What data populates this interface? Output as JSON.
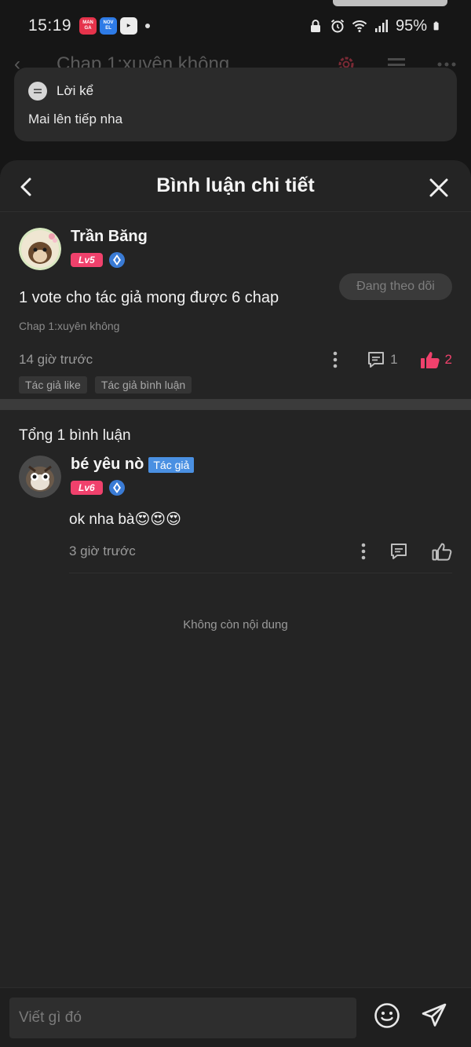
{
  "status_bar": {
    "time": "15:19",
    "apps": [
      "MANGA TOON",
      "NOVEL TOON",
      "video"
    ],
    "battery": "95%"
  },
  "background_screen": {
    "title": "Chap 1:xuyên không"
  },
  "narrator": {
    "label": "Lời kể",
    "text": "Mai lên tiếp nha"
  },
  "sheet": {
    "title": "Bình luận chi tiết"
  },
  "main_comment": {
    "author": "Trần Băng",
    "level": "Lv5",
    "follow_label": "Đang theo dõi",
    "content": "1 vote cho tác giả mong được 6 chap",
    "chapter": "Chap 1:xuyên không",
    "time": "14 giờ trước",
    "reply_count": "1",
    "like_count": "2",
    "tags": [
      "Tác giả like",
      "Tác giả bình luận"
    ]
  },
  "replies": {
    "total_label": "Tổng 1 bình luận",
    "items": [
      {
        "author": "bé yêu nò",
        "author_tag": "Tác giả",
        "level": "Lv6",
        "content": "ok nha bà😍😍😍",
        "time": "3 giờ trước"
      }
    ]
  },
  "end_label": "Không còn nội dung",
  "input": {
    "placeholder": "Viết gì đó"
  },
  "colors": {
    "accent_pink": "#f0416c",
    "author_blue": "#4a90e2",
    "sheet_bg": "#242424"
  }
}
